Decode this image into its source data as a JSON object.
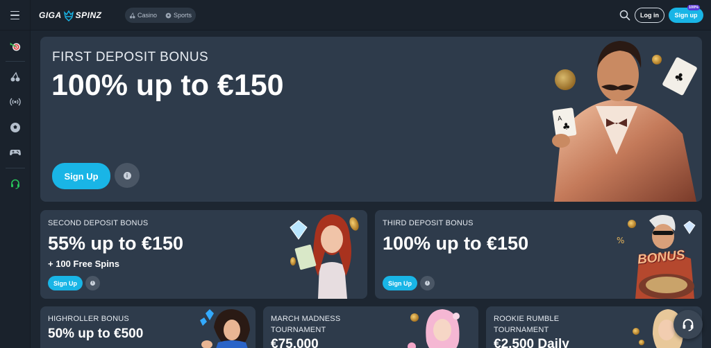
{
  "brand": {
    "left": "GIGA",
    "right": "SPINZ"
  },
  "nav": {
    "casino": "Casino",
    "sports": "Sports"
  },
  "header": {
    "login": "Log in",
    "signup": "Sign up",
    "signup_badge": "100%"
  },
  "colors": {
    "accent": "#19b5e6",
    "card_bg": "#2e3b4b",
    "page_bg": "#1d2631",
    "badge": "#5b3ad8",
    "support_icon": "#27c65a"
  },
  "sidebar": {
    "items": [
      {
        "icon": "target-icon"
      },
      {
        "icon": "cherry-icon"
      },
      {
        "icon": "live-broadcast-icon"
      },
      {
        "icon": "soccer-ball-icon"
      },
      {
        "icon": "gamepad-icon"
      },
      {
        "icon": "headset-icon"
      }
    ]
  },
  "hero": {
    "subtitle": "FIRST DEPOSIT BONUS",
    "title": "100% up to €150",
    "cta": "Sign Up",
    "info": "i"
  },
  "second": {
    "subtitle": "SECOND DEPOSIT BONUS",
    "title": "55% up to €150",
    "extra": "+ 100 Free Spins",
    "cta": "Sign Up",
    "info": "i"
  },
  "third": {
    "subtitle": "THIRD DEPOSIT BONUS",
    "title": "100% up to €150",
    "cta": "Sign Up",
    "info": "i",
    "sign_text": "BONUS"
  },
  "highroller": {
    "subtitle": "HIGHROLLER BONUS",
    "title": "50% up to €500"
  },
  "march": {
    "subtitle_line1": "MARCH MADNESS",
    "subtitle_line2": "TOURNAMENT",
    "title": "€75,000"
  },
  "rookie": {
    "subtitle_line1": "ROOKIE RUMBLE",
    "subtitle_line2": "TOURNAMENT",
    "title": "€2,500 Daily"
  }
}
